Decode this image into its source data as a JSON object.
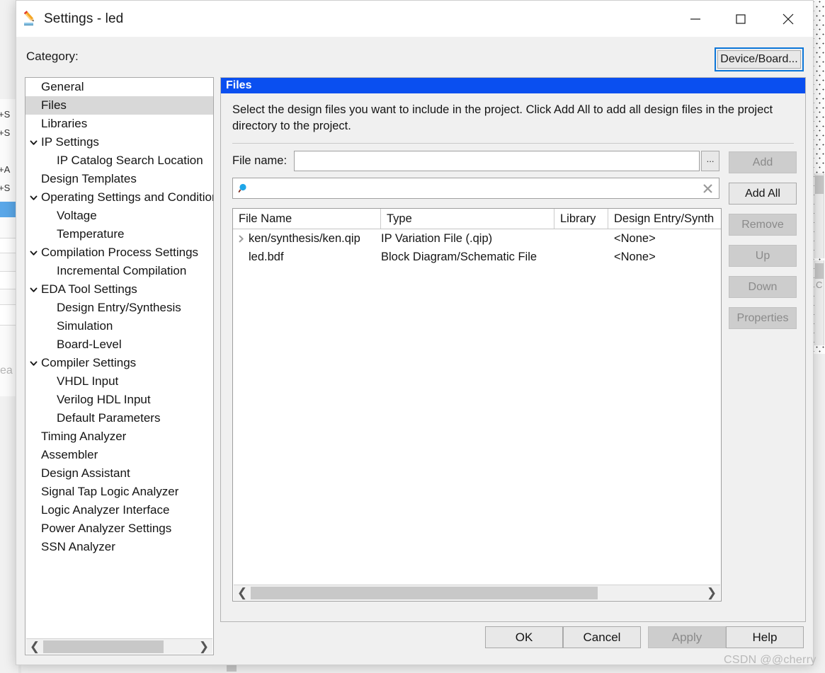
{
  "window": {
    "title": "Settings - led",
    "icon": "pencil-icon",
    "controls": {
      "minimize": "minimize-icon",
      "maximize": "maximize-icon",
      "close": "close-icon"
    }
  },
  "category": {
    "label": "Category:",
    "device_board_button": "Device/Board...",
    "selected": "Files",
    "items": [
      {
        "label": "General",
        "level": 0,
        "expander": "none"
      },
      {
        "label": "Files",
        "level": 0,
        "expander": "none"
      },
      {
        "label": "Libraries",
        "level": 0,
        "expander": "none"
      },
      {
        "label": "IP Settings",
        "level": 0,
        "expander": "expanded"
      },
      {
        "label": "IP Catalog Search Location",
        "level": 1,
        "expander": "none"
      },
      {
        "label": "Design Templates",
        "level": 0,
        "expander": "none"
      },
      {
        "label": "Operating Settings and Conditions",
        "level": 0,
        "expander": "expanded"
      },
      {
        "label": "Voltage",
        "level": 1,
        "expander": "none"
      },
      {
        "label": "Temperature",
        "level": 1,
        "expander": "none"
      },
      {
        "label": "Compilation Process Settings",
        "level": 0,
        "expander": "expanded"
      },
      {
        "label": "Incremental Compilation",
        "level": 1,
        "expander": "none"
      },
      {
        "label": "EDA Tool Settings",
        "level": 0,
        "expander": "expanded"
      },
      {
        "label": "Design Entry/Synthesis",
        "level": 1,
        "expander": "none"
      },
      {
        "label": "Simulation",
        "level": 1,
        "expander": "none"
      },
      {
        "label": "Board-Level",
        "level": 1,
        "expander": "none"
      },
      {
        "label": "Compiler Settings",
        "level": 0,
        "expander": "expanded"
      },
      {
        "label": "VHDL Input",
        "level": 1,
        "expander": "none"
      },
      {
        "label": "Verilog HDL Input",
        "level": 1,
        "expander": "none"
      },
      {
        "label": "Default Parameters",
        "level": 1,
        "expander": "none"
      },
      {
        "label": "Timing Analyzer",
        "level": 0,
        "expander": "none"
      },
      {
        "label": "Assembler",
        "level": 0,
        "expander": "none"
      },
      {
        "label": "Design Assistant",
        "level": 0,
        "expander": "none"
      },
      {
        "label": "Signal Tap Logic Analyzer",
        "level": 0,
        "expander": "none"
      },
      {
        "label": "Logic Analyzer Interface",
        "level": 0,
        "expander": "none"
      },
      {
        "label": "Power Analyzer Settings",
        "level": 0,
        "expander": "none"
      },
      {
        "label": "SSN Analyzer",
        "level": 0,
        "expander": "none"
      }
    ]
  },
  "panel": {
    "title": "Files",
    "description": "Select the design files you want to include in the project. Click Add All to add all design files in the project directory to the project.",
    "file_name_label": "File name:",
    "file_name_value": "",
    "file_name_placeholder": "",
    "browse_button": "...",
    "search_value": "",
    "search_placeholder": "",
    "search_icon": "search-icon",
    "clear_icon": "clear-icon"
  },
  "table": {
    "columns": [
      "File Name",
      "Type",
      "Library",
      "Design Entry/Synthesis Tool"
    ],
    "header_display": [
      "File Name",
      "Type",
      "Library",
      "Design Entry/Synth"
    ],
    "rows": [
      {
        "expander": "collapsed",
        "file_name": "ken/synthesis/ken.qip",
        "type": "IP Variation File (.qip)",
        "library": "",
        "design_entry": "<None>"
      },
      {
        "expander": "none",
        "file_name": "led.bdf",
        "type": "Block Diagram/Schematic File",
        "library": "",
        "design_entry": "<None>"
      }
    ]
  },
  "side_buttons": [
    {
      "label": "Add",
      "enabled": false
    },
    {
      "label": "Add All",
      "enabled": true
    },
    {
      "label": "Remove",
      "enabled": false
    },
    {
      "label": "Up",
      "enabled": false
    },
    {
      "label": "Down",
      "enabled": false
    },
    {
      "label": "Properties",
      "enabled": false
    }
  ],
  "footer_buttons": [
    {
      "label": "OK",
      "enabled": true
    },
    {
      "label": "Cancel",
      "enabled": true
    },
    {
      "label": "Apply",
      "enabled": false
    },
    {
      "label": "Help",
      "enabled": true
    }
  ],
  "watermark": "CSDN @@cherry",
  "background": {
    "shortcut_fragments": [
      "+S",
      "+S",
      "+A",
      "+S"
    ],
    "text_fragment": "ea",
    "right_char": "C"
  },
  "colors": {
    "panel_title_bg": "#0a4ff0",
    "focus_ring": "#0c76d8",
    "selection": "#d8d8d8",
    "backdrop_highlight": "#5aa7e8"
  }
}
